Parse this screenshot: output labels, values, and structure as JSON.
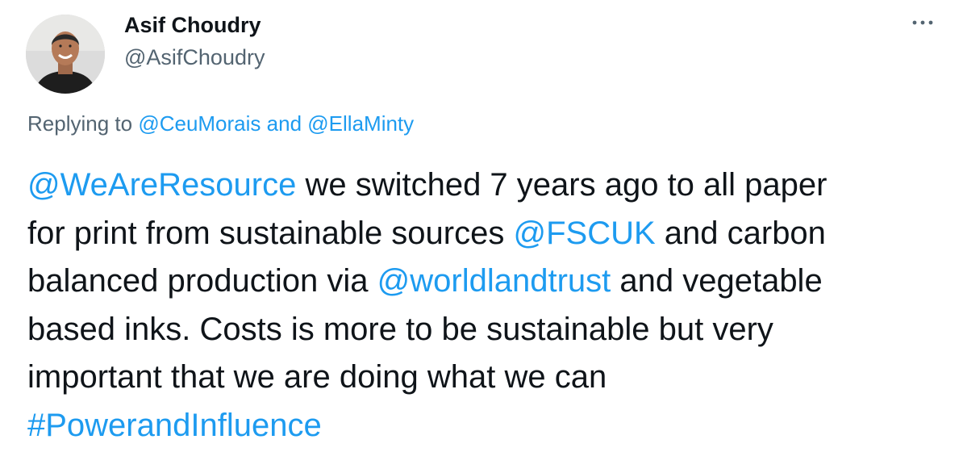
{
  "author": {
    "display_name": "Asif Choudry",
    "handle": "@AsifChoudry"
  },
  "more_icon": "more-horizontal-icon",
  "reply": {
    "prefix": "Replying to",
    "mention1": "@CeuMorais",
    "joiner": "and",
    "mention2": "@EllaMinty"
  },
  "tweet": {
    "mention_resource": "@WeAreResource",
    "t1": " we switched 7 years ago to all paper",
    "t2": "for print from sustainable sources ",
    "mention_fsc": "@FSCUK",
    "t3": " and carbon",
    "t4": "balanced production via ",
    "mention_wlt": "@worldlandtrust",
    "t5": " and vegetable",
    "t6": "based inks. Costs is more to be sustainable but very",
    "t7": "important that we are doing what we can",
    "hashtag": "#PowerandInfluence"
  },
  "colors": {
    "link": "#1d9bf0",
    "secondary": "#536471",
    "text": "#0f1419"
  }
}
